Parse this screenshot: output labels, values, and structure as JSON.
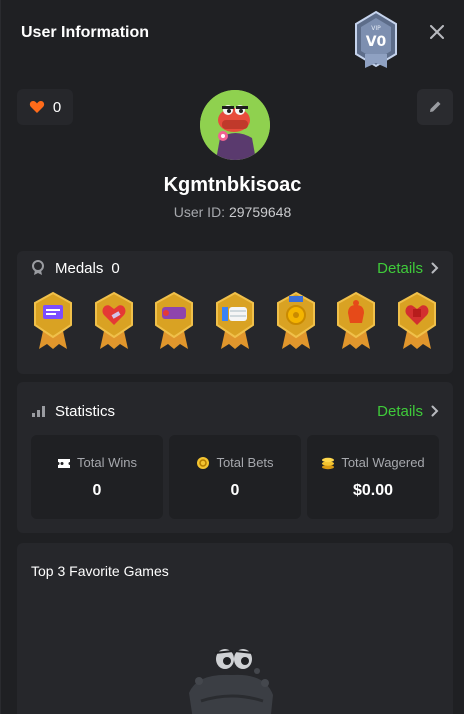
{
  "header": {
    "title": "User Information",
    "vip_level": "V0",
    "vip_tag": "VIP"
  },
  "profile": {
    "likes": "0",
    "username": "Kgmtnbkisoac",
    "user_id_label": "User ID:",
    "user_id": "29759648"
  },
  "medals": {
    "label": "Medals",
    "count": "0",
    "details_label": "Details",
    "items": [
      {
        "icon": "chat-medal-icon",
        "color": "#7c4dff"
      },
      {
        "icon": "heart-medal-icon",
        "color": "#e53935"
      },
      {
        "icon": "ticket-medal-icon",
        "color": "#8e44ad"
      },
      {
        "icon": "thumbs-up-medal-icon",
        "color": "#3b82f6"
      },
      {
        "icon": "coin-medal-icon",
        "color": "#f4b400"
      },
      {
        "icon": "bag-medal-icon",
        "color": "#e64a19"
      },
      {
        "icon": "dice-medal-icon",
        "color": "#d32f2f"
      }
    ]
  },
  "statistics": {
    "label": "Statistics",
    "details_label": "Details",
    "items": [
      {
        "label": "Total Wins",
        "value": "0",
        "icon": "ticket-icon"
      },
      {
        "label": "Total Bets",
        "value": "0",
        "icon": "chip-icon"
      },
      {
        "label": "Total Wagered",
        "value": "$0.00",
        "icon": "coins-icon"
      }
    ]
  },
  "favorites": {
    "title": "Top 3 Favorite Games"
  },
  "colors": {
    "accent_green": "#3fcb3a",
    "heart": "#ff6b1a",
    "gold": "#f4c430"
  }
}
